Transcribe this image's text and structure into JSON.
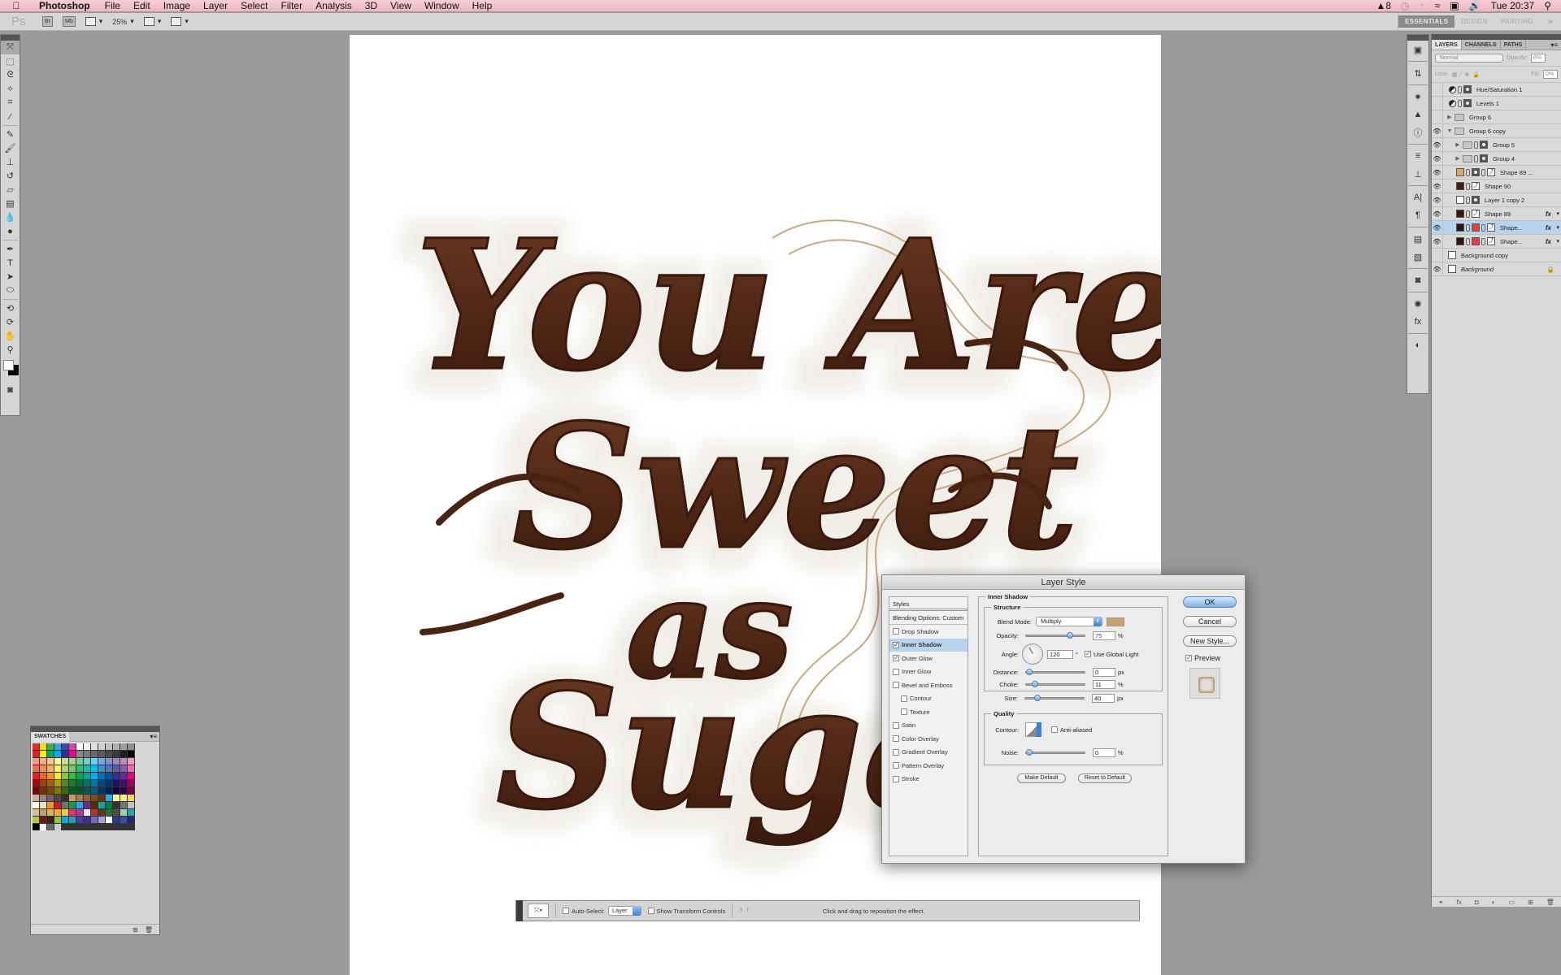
{
  "menubar": {
    "app_name": "Photoshop",
    "items": [
      "File",
      "Edit",
      "Image",
      "Layer",
      "Select",
      "Filter",
      "Analysis",
      "3D",
      "View",
      "Window",
      "Help"
    ],
    "status": {
      "adobe_badge": "8",
      "clock": "Tue 20:37",
      "icons": [
        "adobe-icon",
        "time-machine-icon",
        "bluetooth-icon",
        "wifi-icon",
        "input-menu-icon",
        "volume-icon",
        "spotlight-icon"
      ]
    }
  },
  "appbar": {
    "ps_logo": "Ps",
    "bridge_label": "Br",
    "minibridge_label": "Mb",
    "zoom": "25%",
    "workspaces": [
      {
        "label": "ESSENTIALS",
        "active": true
      },
      {
        "label": "DESIGN",
        "active": false
      },
      {
        "label": "PAINTING",
        "active": false
      }
    ],
    "more": "»"
  },
  "toolbox": {
    "tools": [
      {
        "name": "move-tool",
        "glyph": "⤧",
        "selected": true
      },
      {
        "name": "marquee-tool",
        "glyph": "⬚"
      },
      {
        "name": "lasso-tool",
        "glyph": "ᘓ"
      },
      {
        "name": "quick-select-tool",
        "glyph": "✧"
      },
      {
        "name": "crop-tool",
        "glyph": "⌗"
      },
      {
        "name": "eyedropper-tool",
        "glyph": "⁄"
      },
      {
        "name": "sep"
      },
      {
        "name": "healing-brush-tool",
        "glyph": "✎"
      },
      {
        "name": "brush-tool",
        "glyph": "🖌"
      },
      {
        "name": "clone-stamp-tool",
        "glyph": "⊥"
      },
      {
        "name": "history-brush-tool",
        "glyph": "↺"
      },
      {
        "name": "eraser-tool",
        "glyph": "▱"
      },
      {
        "name": "gradient-tool",
        "glyph": "▤"
      },
      {
        "name": "blur-tool",
        "glyph": "💧"
      },
      {
        "name": "dodge-tool",
        "glyph": "●"
      },
      {
        "name": "sep"
      },
      {
        "name": "pen-tool",
        "glyph": "✒"
      },
      {
        "name": "type-tool",
        "glyph": "T"
      },
      {
        "name": "path-selection-tool",
        "glyph": "➤"
      },
      {
        "name": "ellipse-tool",
        "glyph": "⬭"
      },
      {
        "name": "sep"
      },
      {
        "name": "3d-rotate-tool",
        "glyph": "⟲"
      },
      {
        "name": "3d-orbit-tool",
        "glyph": "⟳"
      },
      {
        "name": "hand-tool",
        "glyph": "✋"
      },
      {
        "name": "zoom-tool",
        "glyph": "⚲"
      }
    ],
    "quick_mask_glyph": "◙"
  },
  "canvas": {
    "artwork_text": [
      "You Are",
      "Sweet",
      "as",
      "Sugar"
    ],
    "chocolate_color": "#4a2413"
  },
  "swatches": {
    "title": "SWATCHES",
    "colors": [
      "#e8262c",
      "#f6e500",
      "#3bb04a",
      "#2fa8df",
      "#3a4da3",
      "#c94a9e",
      "#ffffff",
      "#f0f0f0",
      "#e0e0e0",
      "#d0d0d0",
      "#c0c0c0",
      "#b0b0b0",
      "#a0a0a0",
      "#909090",
      "#e01f26",
      "#fff200",
      "#00a651",
      "#00aeef",
      "#2e3192",
      "#ec008c",
      "#8a8a8a",
      "#7a7a7a",
      "#6a6a6a",
      "#5a5a5a",
      "#4a4a4a",
      "#3a3a3a",
      "#1e1e1e",
      "#000000",
      "#f59a8b",
      "#f9ad81",
      "#fdc689",
      "#fff799",
      "#c4df9b",
      "#a3d39c",
      "#82ca9c",
      "#7accc8",
      "#6dcff6",
      "#7da7d9",
      "#8393ca",
      "#a187be",
      "#bd8cbf",
      "#f49ac1",
      "#f26c4f",
      "#f68e56",
      "#fbaf5d",
      "#fff467",
      "#acd372",
      "#7cc576",
      "#3bb878",
      "#1abbb4",
      "#00bff3",
      "#438ccb",
      "#5574b9",
      "#605ca8",
      "#855fa8",
      "#f06ea9",
      "#ed1c24",
      "#f26522",
      "#f7941d",
      "#fff200",
      "#8dc63f",
      "#39b54a",
      "#00a651",
      "#00a99d",
      "#00aeef",
      "#0072bc",
      "#0054a6",
      "#2e3192",
      "#662d91",
      "#ec008c",
      "#9e0b0f",
      "#a0410d",
      "#a3620a",
      "#aba000",
      "#598527",
      "#197b30",
      "#007236",
      "#00746b",
      "#0076a3",
      "#004a80",
      "#003471",
      "#1b1464",
      "#440e62",
      "#9e005d",
      "#790000",
      "#7b2e00",
      "#7d4900",
      "#827b00",
      "#406618",
      "#005e20",
      "#005826",
      "#005952",
      "#005b7f",
      "#003663",
      "#002157",
      "#0d004c",
      "#32004b",
      "#7b0046",
      "#c7b299",
      "#998675",
      "#736357",
      "#534741",
      "#37302d",
      "#c69c6d",
      "#a67c52",
      "#8c6239",
      "#754c24",
      "#603913",
      "#29abe2",
      "#fff799",
      "#fbed85",
      "#fbd862",
      "#fdfbe3",
      "#e8e0c0",
      "#f7941d",
      "#c9202a",
      "#737373",
      "#0e9c57",
      "#29abe2",
      "#662d91",
      "#5a2a00",
      "#12a5a0",
      "#007f3f",
      "#333333",
      "#777777",
      "#c2c2c2",
      "#d1c38a",
      "#bca56c",
      "#e0b05b",
      "#f5ab35",
      "#f2c94c",
      "#ee2a7b",
      "#a63d96",
      "#fbe0ef",
      "#a13d2d",
      "#6d2e1f",
      "#256f3a",
      "#4d4d4d",
      "#9ad4b8",
      "#28a3b0",
      "#a6ce39",
      "#75131a",
      "#391f1a",
      "#8dc63f",
      "#1ba3dc",
      "#2a9db2",
      "#4d3f99",
      "#343391",
      "#7d67b4",
      "#a99ed6",
      "#ffffff",
      "#2b388f",
      "#3b4da0",
      "#1e2b6b",
      "#000000",
      "#ffffff",
      "#666666",
      "#cccccc"
    ],
    "footer_icons": [
      "new-swatch-icon",
      "trash-icon"
    ]
  },
  "iconstrip": {
    "groups": [
      [
        "mini-bridge-icon"
      ],
      [
        "history-icon"
      ],
      [
        "navigator-icon",
        "histogram-icon",
        "info-icon"
      ],
      [
        "brush-presets-icon",
        "clone-source-icon"
      ],
      [
        "character-icon",
        "paragraph-icon"
      ],
      [
        "layer-comps-icon",
        "tool-presets-icon"
      ],
      [
        "masks-icon"
      ],
      [
        "color-styles-icon",
        "styles-icon"
      ],
      [
        "adjustments-icon"
      ]
    ],
    "glyphs": {
      "mini-bridge-icon": "▣",
      "history-icon": "⇅",
      "navigator-icon": "✷",
      "histogram-icon": "▲",
      "info-icon": "ⓘ",
      "brush-presets-icon": "≡",
      "clone-source-icon": "⊥",
      "character-icon": "A|",
      "paragraph-icon": "¶",
      "layer-comps-icon": "▤",
      "tool-presets-icon": "▧",
      "masks-icon": "◙",
      "color-styles-icon": "✺",
      "styles-icon": "fx",
      "adjustments-icon": "◐"
    }
  },
  "layers_panel": {
    "tabs": [
      {
        "label": "LAYERS",
        "active": true
      },
      {
        "label": "CHANNELS",
        "active": false
      },
      {
        "label": "PATHS",
        "active": false
      }
    ],
    "blend_mode": "Normal",
    "opacity_label": "Opacity:",
    "opacity": "0%",
    "lock_label": "Lock:",
    "fill_label": "Fill:",
    "fill": "0%",
    "layers": [
      {
        "name": "Hue/Saturation 1",
        "visible": false,
        "kind": "adjustment",
        "depth": 0
      },
      {
        "name": "Levels 1",
        "visible": false,
        "kind": "adjustment",
        "depth": 0
      },
      {
        "name": "Group 6",
        "visible": false,
        "kind": "group",
        "expanded": false,
        "depth": 0
      },
      {
        "name": "Group 6 copy",
        "visible": true,
        "kind": "group",
        "expanded": true,
        "depth": 0
      },
      {
        "name": "Group 5",
        "visible": true,
        "kind": "group-mask",
        "expanded": false,
        "depth": 1
      },
      {
        "name": "Group 4",
        "visible": true,
        "kind": "group-mask",
        "expanded": false,
        "depth": 1
      },
      {
        "name": "Shape 89 ...",
        "visible": true,
        "kind": "shape-mask",
        "swatch": "#d9a86c",
        "depth": 1
      },
      {
        "name": "Shape 90",
        "visible": true,
        "kind": "shape",
        "swatch": "#4a1a12",
        "depth": 1
      },
      {
        "name": "Layer 1 copy 2",
        "visible": true,
        "kind": "pixel-mask",
        "depth": 1
      },
      {
        "name": "Shape 89",
        "visible": true,
        "kind": "shape",
        "swatch": "#3e1710",
        "fx": true,
        "depth": 1
      },
      {
        "name": "Shape...",
        "visible": true,
        "kind": "shape-redmask",
        "swatch": "#2e1510",
        "fx": true,
        "selected": true,
        "depth": 1
      },
      {
        "name": "Shape...",
        "visible": true,
        "kind": "shape-redmask",
        "swatch": "#2e1510",
        "fx": true,
        "depth": 1
      },
      {
        "name": "Background copy",
        "visible": false,
        "kind": "pixel",
        "depth": 0
      },
      {
        "name": "Background",
        "visible": true,
        "kind": "pixel",
        "locked": true,
        "italic": true,
        "depth": 0
      }
    ],
    "footer_icons": [
      "link-layers-icon",
      "add-style-icon",
      "add-mask-icon",
      "new-adjustment-icon",
      "new-group-icon",
      "new-layer-icon",
      "delete-layer-icon"
    ],
    "footer_glyphs": [
      "⚭",
      "fx",
      "◘",
      "◐",
      "▭",
      "⊞",
      "🗑"
    ]
  },
  "layer_style_dialog": {
    "title": "Layer Style",
    "styles_header": "Styles",
    "blending_options": "Blending Options: Custom",
    "styles": [
      {
        "label": "Drop Shadow",
        "checked": false
      },
      {
        "label": "Inner Shadow",
        "checked": true,
        "active": true
      },
      {
        "label": "Outer Glow",
        "checked": true
      },
      {
        "label": "Inner Glow",
        "checked": false
      },
      {
        "label": "Bevel and Emboss",
        "checked": false
      },
      {
        "label": "Contour",
        "checked": false,
        "sub": true
      },
      {
        "label": "Texture",
        "checked": false,
        "sub": true
      },
      {
        "label": "Satin",
        "checked": false
      },
      {
        "label": "Color Overlay",
        "checked": false
      },
      {
        "label": "Gradient Overlay",
        "checked": false
      },
      {
        "label": "Pattern Overlay",
        "checked": false
      },
      {
        "label": "Stroke",
        "checked": false
      }
    ],
    "section_title": "Inner Shadow",
    "structure": {
      "title": "Structure",
      "blend_mode_label": "Blend Mode:",
      "blend_mode": "Multiply",
      "shadow_color": "#c9a06e",
      "opacity_label": "Opacity:",
      "opacity": "75",
      "opacity_fraction": 0.75,
      "opacity_unit": "%",
      "angle_label": "Angle:",
      "angle": "120",
      "angle_unit": "°",
      "use_global_light_label": "Use Global Light",
      "use_global_light": true,
      "distance_label": "Distance:",
      "distance": "0",
      "distance_fraction": 0.0,
      "distance_unit": "px",
      "choke_label": "Choke:",
      "choke": "11",
      "choke_fraction": 0.11,
      "choke_unit": "%",
      "size_label": "Size:",
      "size": "40",
      "size_fraction": 0.16,
      "size_unit": "px"
    },
    "quality": {
      "title": "Quality",
      "contour_label": "Contour:",
      "anti_aliased_label": "Anti-aliased",
      "anti_aliased": false,
      "noise_label": "Noise:",
      "noise": "0",
      "noise_fraction": 0.0,
      "noise_unit": "%"
    },
    "make_default": "Make Default",
    "reset_default": "Reset to Default",
    "ok": "OK",
    "cancel": "Cancel",
    "new_style": "New Style...",
    "preview_label": "Preview",
    "preview": true
  },
  "move_options": {
    "auto_select_label": "Auto-Select:",
    "auto_select": false,
    "auto_select_target": "Layer",
    "show_transform_label": "Show Transform Controls",
    "show_transform": false,
    "hint": "Click and drag to reposition the effect."
  }
}
